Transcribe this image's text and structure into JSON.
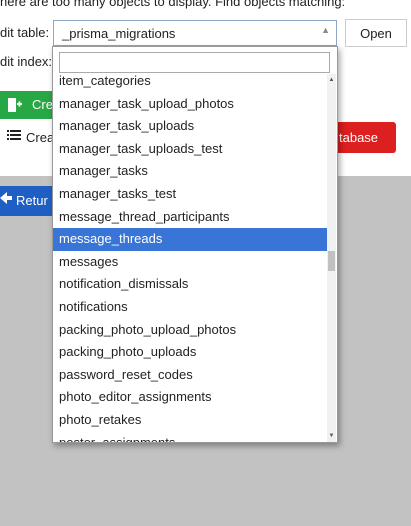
{
  "notice": "here are too many objects to display. Find objects matching:",
  "labels": {
    "edit_table": "dit table:",
    "edit_index": "dit index:"
  },
  "select": {
    "value": "_prisma_migrations",
    "arrow": "▲"
  },
  "open_button": "Open",
  "green_button": {
    "icon": "plus-icon",
    "label": "Cre"
  },
  "create_row": {
    "icon": "list-icon",
    "label": "Crea"
  },
  "red_button": {
    "label": "tabase"
  },
  "blue_button": {
    "icon": "return-icon",
    "label": "Retur"
  },
  "dropdown": {
    "search_value": "",
    "items": [
      "item_categories",
      "manager_task_upload_photos",
      "manager_task_uploads",
      "manager_task_uploads_test",
      "manager_tasks",
      "manager_tasks_test",
      "message_thread_participants",
      "message_threads",
      "messages",
      "notification_dismissals",
      "notifications",
      "packing_photo_upload_photos",
      "packing_photo_uploads",
      "password_reset_codes",
      "photo_editor_assignments",
      "photo_retakes",
      "poster_assignments"
    ],
    "selected": "message_threads"
  },
  "colors": {
    "selected": "#3875d7",
    "green": "#28a745",
    "red": "#dc1f1f",
    "blue": "#1f5fc4",
    "backdrop": "#c2c2c2"
  }
}
